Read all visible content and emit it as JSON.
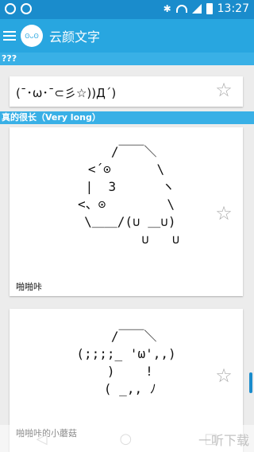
{
  "status": {
    "time": "13:27"
  },
  "app": {
    "title": "云颜文字",
    "logo_text": "ʘᴗʘ"
  },
  "sections": [
    {
      "label": "???"
    },
    {
      "label": "真的很长（Very long）"
    }
  ],
  "cards": [
    {
      "kaomoji": "(¯･ω･¯⊂彡☆))Д´)"
    },
    {
      "art": "  /￣￣＼\n<´⊙      \\\n |  3      ヽ\n<、⊙        \\\n \\＿＿/(∪ ＿∪)\n         ∪   ∪",
      "caption": "啪啪咔"
    },
    {
      "art": "  /￣￣＼\n(;;;;_ 'ω',,)\n )    !\n ( _,, ﾉ",
      "caption": "啪啪咔的小蘑菇"
    }
  ],
  "colors": {
    "statusbar": "#1a8ccc",
    "appbar": "#28a6e0",
    "section": "#39b0e6"
  },
  "watermark": "一听下载"
}
